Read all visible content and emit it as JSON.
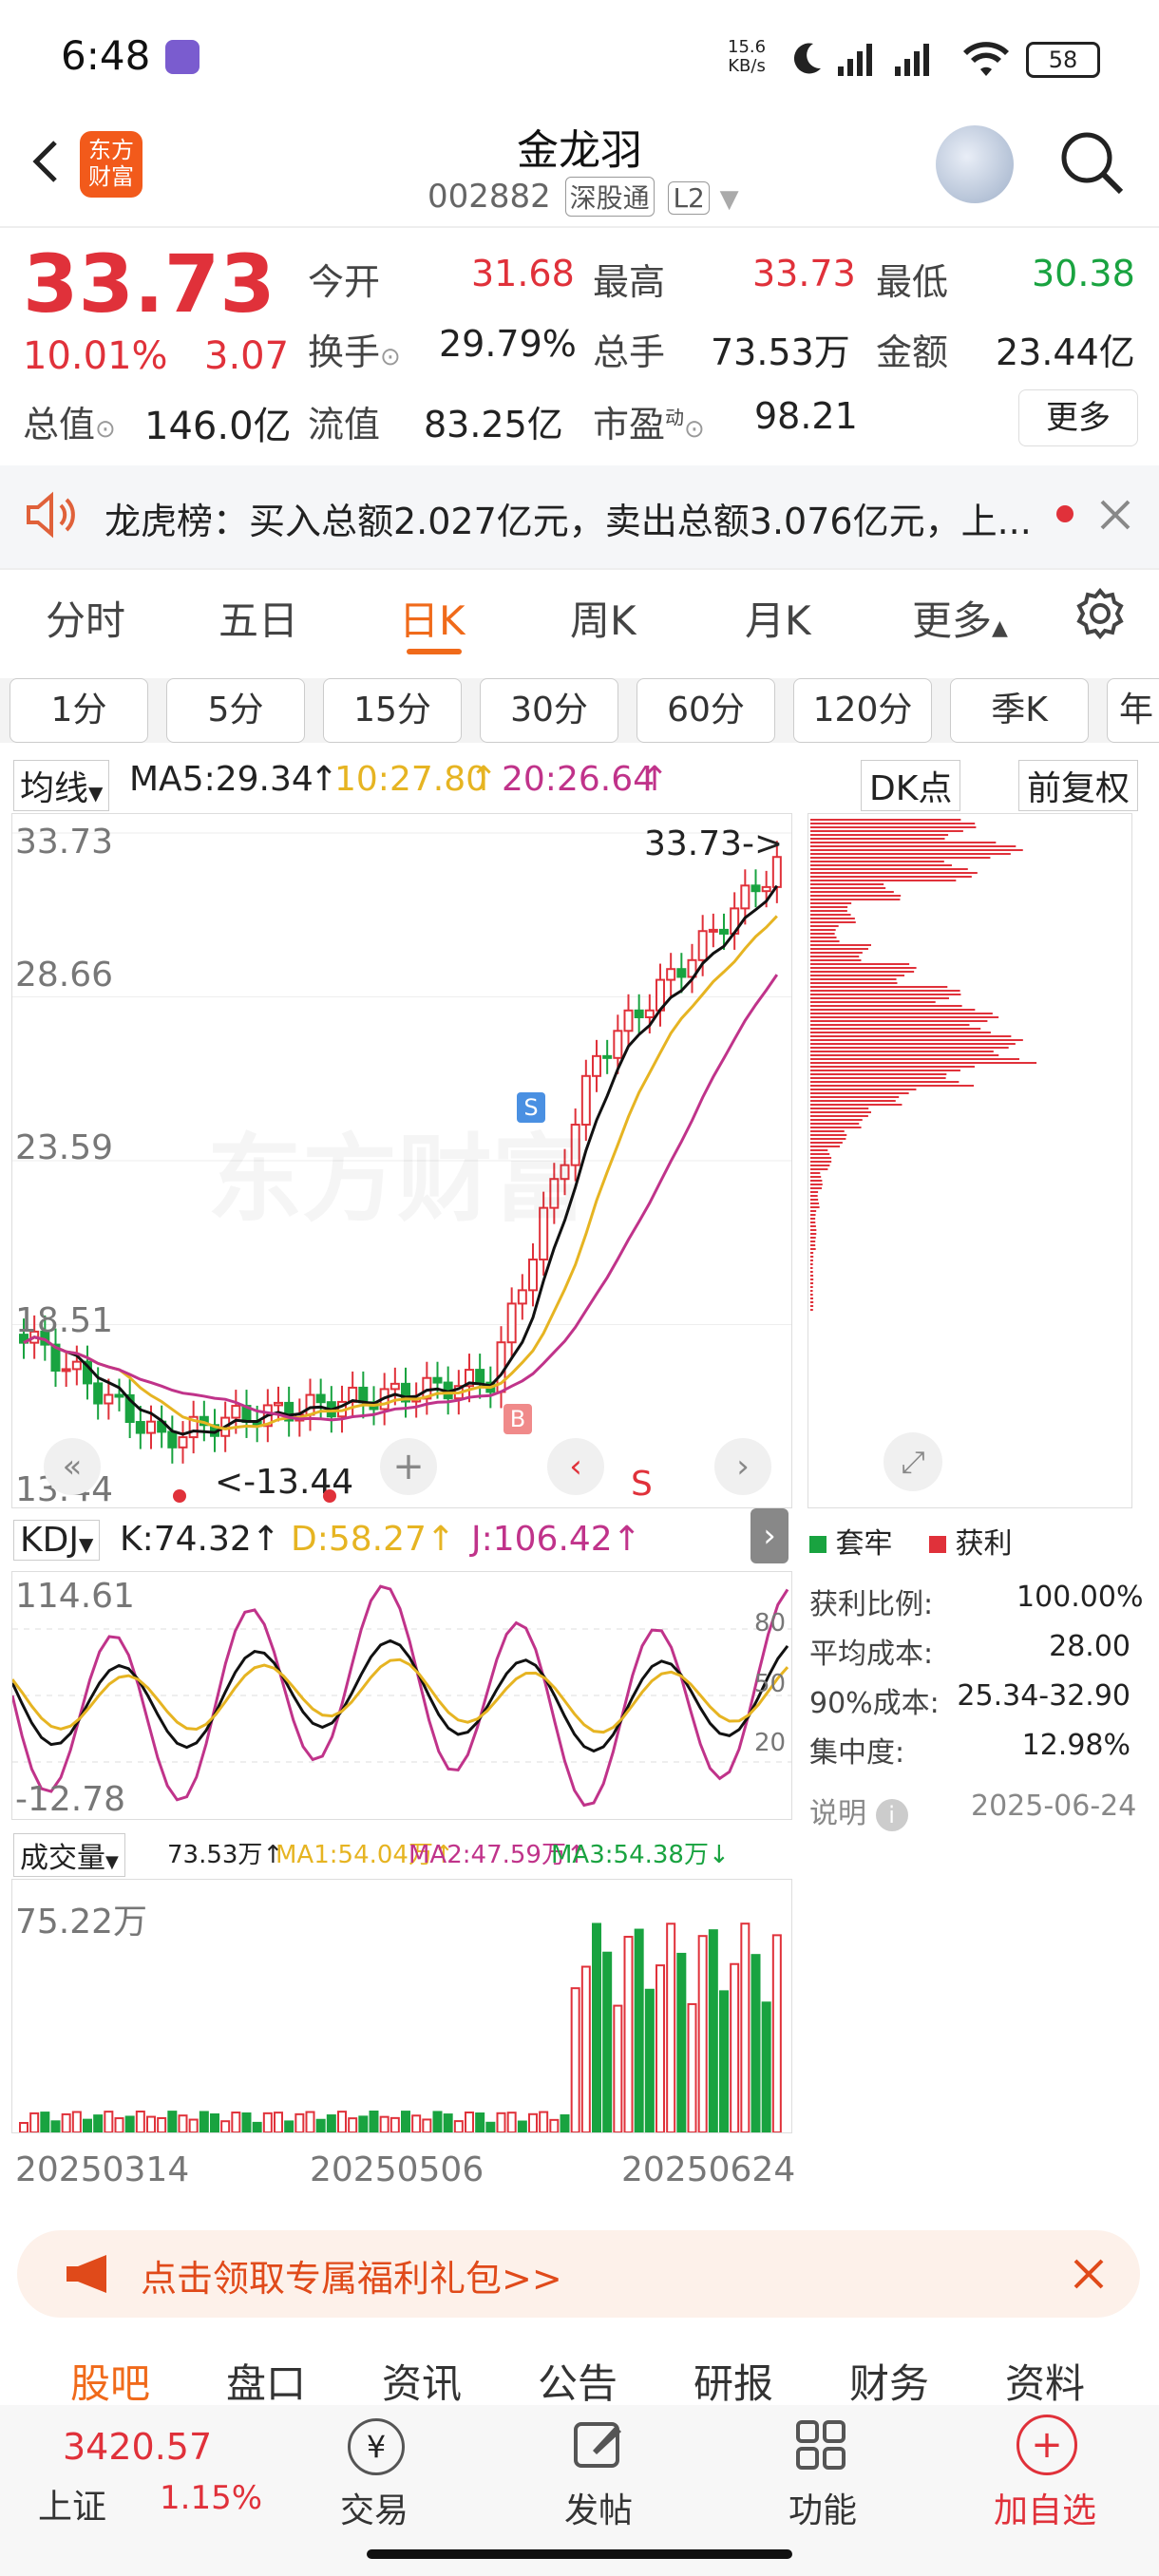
{
  "status_bar": {
    "time": "6:48",
    "net_speed_top": "15.6",
    "net_speed_bottom": "KB/s",
    "battery": "58"
  },
  "header": {
    "logo_line1": "东方",
    "logo_line2": "财富",
    "title": "金龙羽",
    "code": "002882",
    "tag1": "深股通",
    "tag2": "L2"
  },
  "quote": {
    "price": "33.73",
    "pct": "10.01%",
    "change": "3.07",
    "open_label": "今开",
    "open": "31.68",
    "high_label": "最高",
    "high": "33.73",
    "low_label": "最低",
    "low": "30.38",
    "turnover_label": "换手",
    "turnover": "29.79%",
    "volume_label": "总手",
    "volume": "73.53万",
    "amount_label": "金额",
    "amount": "23.44亿",
    "mktcap_label": "总值",
    "mktcap": "146.0亿",
    "float_label": "流值",
    "float": "83.25亿",
    "pe_label": "市盈",
    "pe_sup": "动",
    "pe": "98.21",
    "more": "更多"
  },
  "news": {
    "text": "龙虎榜：买入总额2.027亿元，卖出总额3.076亿元，上..."
  },
  "tabs": [
    "分时",
    "五日",
    "日K",
    "周K",
    "月K",
    "更多"
  ],
  "periods": [
    "1分",
    "5分",
    "15分",
    "30分",
    "60分",
    "120分",
    "季K",
    "年"
  ],
  "ma_legend": {
    "selector": "均线",
    "ma5": "MA5:29.34",
    "ma10": "10:27.80",
    "ma20": "20:26.64",
    "dk": "DK点",
    "fq": "前复权"
  },
  "kline": {
    "y_labels": [
      "33.73",
      "28.66",
      "23.59",
      "18.51",
      "13.44"
    ],
    "high_marker": "33.73->",
    "low_marker": "<-13.44",
    "watermark": "东方财富",
    "buy_marker": "B",
    "sell_marker": "S",
    "s_marker": "S"
  },
  "chip": {
    "legend_trapped": "套牢",
    "legend_profit": "获利",
    "rows": [
      {
        "label": "获利比例:",
        "value": "100.00%"
      },
      {
        "label": "平均成本:",
        "value": "28.00"
      },
      {
        "label": "90%成本:",
        "value": "25.34-32.90"
      },
      {
        "label": "集中度:",
        "value": "12.98%"
      }
    ],
    "note": "说明",
    "date": "2025-06-24",
    "colors": {
      "profit": "#e0313a",
      "trapped": "#19a340"
    }
  },
  "kdj": {
    "selector": "KDJ",
    "k": "K:74.32",
    "d": "D:58.27",
    "j": "J:106.42",
    "y_top": "114.61",
    "y_bottom": "-12.78",
    "ref80": "80",
    "ref50": "50",
    "ref20": "20"
  },
  "vol": {
    "selector": "成交量",
    "vol": "73.53万",
    "ma1": "MA1:54.04万",
    "ma2": "MA2:47.59万",
    "ma3": "MA3:54.38万",
    "y_top": "75.22万",
    "dates": [
      "20250314",
      "20250506",
      "20250624"
    ]
  },
  "banner": {
    "text": "点击领取专属福利礼包>>"
  },
  "bottom_tabs": [
    "股吧",
    "盘口",
    "资讯",
    "公告",
    "研报",
    "财务",
    "资料"
  ],
  "footer": {
    "index_value": "3420.57",
    "index_name": "上证",
    "index_pct": "1.15%",
    "trade": "交易",
    "post": "发帖",
    "func": "功能",
    "watch": "加自选"
  },
  "chart_data": {
    "type": "candlestick",
    "ylim": [
      13.44,
      33.73
    ],
    "x_dates": [
      "20250314",
      "20250506",
      "20250624"
    ],
    "notable": {
      "high": 33.73,
      "low": 13.44,
      "last_close": 33.73
    },
    "ma": {
      "MA5": 29.34,
      "MA10": 27.8,
      "MA20": 26.64
    }
  }
}
